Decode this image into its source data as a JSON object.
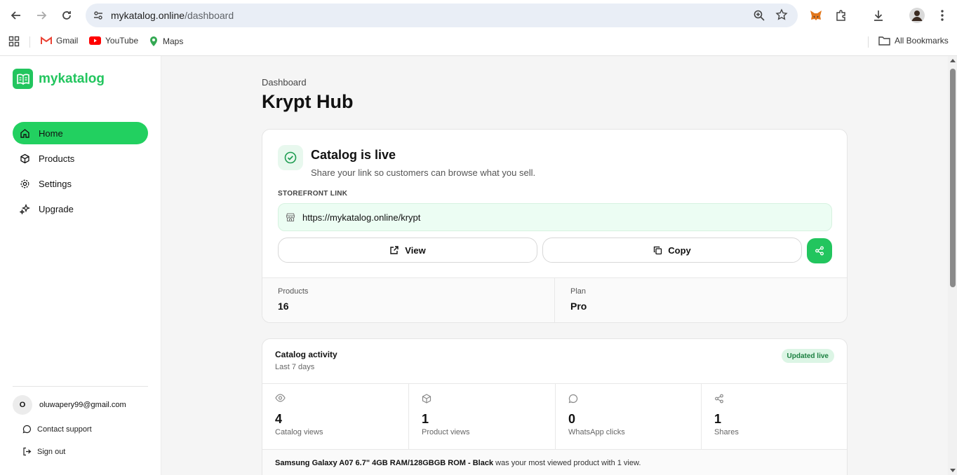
{
  "browser": {
    "url_host": "mykatalog.online",
    "url_path": "/dashboard",
    "bookmarks": [
      "Gmail",
      "YouTube",
      "Maps"
    ],
    "all_bookmarks": "All Bookmarks"
  },
  "sidebar": {
    "brand": "mykatalog",
    "items": [
      {
        "label": "Home",
        "icon": "home-icon",
        "active": true
      },
      {
        "label": "Products",
        "icon": "box-icon"
      },
      {
        "label": "Settings",
        "icon": "gear-icon"
      },
      {
        "label": "Upgrade",
        "icon": "sparkle-icon"
      }
    ],
    "user": {
      "initial": "O",
      "email": "oluwapery99@gmail.com"
    },
    "contact_support": "Contact support",
    "sign_out": "Sign out"
  },
  "main": {
    "breadcrumb": "Dashboard",
    "title": "Krypt Hub",
    "live_card": {
      "title": "Catalog is live",
      "subtitle": "Share your link so customers can browse what you sell.",
      "storefront_label": "STOREFRONT LINK",
      "storefront_url": "https://mykatalog.online/krypt",
      "view_label": "View",
      "copy_label": "Copy",
      "stats": [
        {
          "label": "Products",
          "value": "16"
        },
        {
          "label": "Plan",
          "value": "Pro"
        }
      ]
    },
    "activity": {
      "title": "Catalog activity",
      "subtitle": "Last 7 days",
      "badge": "Updated live",
      "metrics": [
        {
          "value": "4",
          "label": "Catalog views",
          "icon": "eye-icon"
        },
        {
          "value": "1",
          "label": "Product views",
          "icon": "box-icon"
        },
        {
          "value": "0",
          "label": "WhatsApp clicks",
          "icon": "chat-icon"
        },
        {
          "value": "1",
          "label": "Shares",
          "icon": "share-icon"
        }
      ],
      "top_product": "Samsung Galaxy A07 6.7\" 4GB RAM/128GBGB ROM - Black",
      "top_product_suffix": " was your most viewed product with 1 view."
    }
  },
  "colors": {
    "accent": "#22c55e",
    "active_nav": "#22d060"
  }
}
